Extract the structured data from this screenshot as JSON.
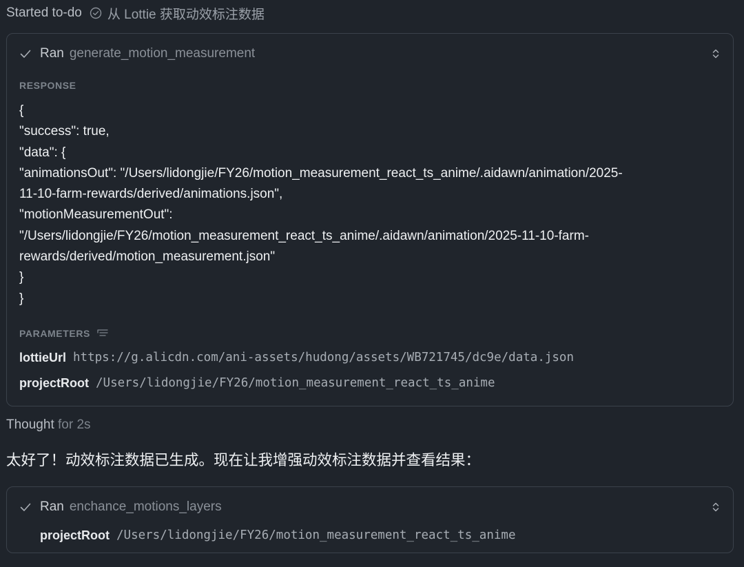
{
  "todo": {
    "status": "Started to-do",
    "icon": "check-circle-icon",
    "title": "从 Lottie 获取动效标注数据"
  },
  "tool_call_1": {
    "status_icon": "check-icon",
    "verb": "Ran",
    "tool_name": "generate_motion_measurement",
    "toggle_icon": "chevron-up-down-icon",
    "response_label": "RESPONSE",
    "response_lines": [
      "{",
      "\"success\": true,",
      "\"data\": {",
      "\"animationsOut\": \"/Users/lidongjie/FY26/motion_measurement_react_ts_anime/.aidawn/animation/2025-",
      "11-10-farm-rewards/derived/animations.json\",",
      "\"motionMeasurementOut\":",
      "\"/Users/lidongjie/FY26/motion_measurement_react_ts_anime/.aidawn/animation/2025-11-10-farm-",
      "rewards/derived/motion_measurement.json\"",
      "}",
      "}"
    ],
    "parameters_label": "PARAMETERS",
    "parameters_icon": "list-icon",
    "parameters": [
      {
        "key": "lottieUrl",
        "value": "https://g.alicdn.com/ani-assets/hudong/assets/WB721745/dc9e/data.json"
      },
      {
        "key": "projectRoot",
        "value": "/Users/lidongjie/FY26/motion_measurement_react_ts_anime"
      }
    ]
  },
  "thought": {
    "label": "Thought",
    "duration": "for 2s"
  },
  "message": "太好了！动效标注数据已生成。现在让我增强动效标注数据并查看结果：",
  "tool_call_2": {
    "status_icon": "check-icon",
    "verb": "Ran",
    "tool_name": "enchance_motions_layers",
    "toggle_icon": "chevron-up-down-icon",
    "parameters": [
      {
        "key": "projectRoot",
        "value": "/Users/lidongjie/FY26/motion_measurement_react_ts_anime"
      }
    ]
  },
  "colors": {
    "background": "#1f242b",
    "card_border": "#3b424b",
    "muted_text": "#7d848c",
    "primary_text": "#eef0f2"
  }
}
